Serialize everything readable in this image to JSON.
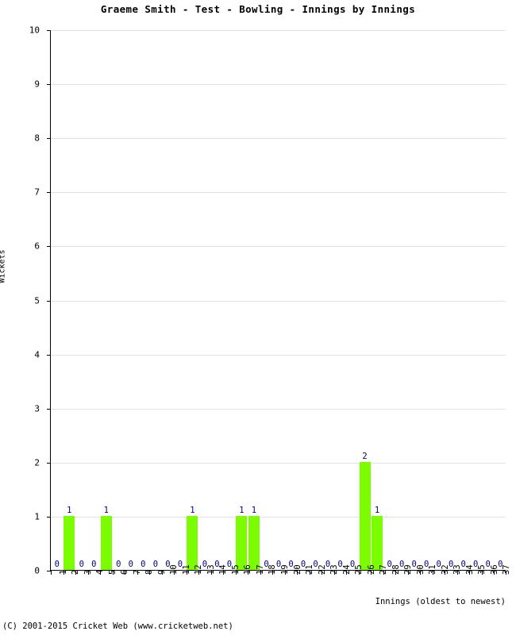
{
  "chart_data": {
    "type": "bar",
    "title": "Graeme Smith - Test - Bowling - Innings by Innings",
    "xlabel": "Innings (oldest to newest)",
    "ylabel": "Wickets",
    "ylim": [
      0,
      10
    ],
    "ytick_labels": [
      "0",
      "1",
      "2",
      "3",
      "4",
      "5",
      "6",
      "7",
      "8",
      "9",
      "10"
    ],
    "ytick_values": [
      0,
      1,
      2,
      3,
      4,
      5,
      6,
      7,
      8,
      9,
      10
    ],
    "grid": true,
    "legend": null,
    "bar_color": "#7CFC00",
    "value_label_color": "#000080",
    "gridline_color": "#E2E2E2",
    "axis_color": "#000000",
    "categories": [
      "1",
      "2",
      "3",
      "4",
      "5",
      "6",
      "7",
      "8",
      "9",
      "10",
      "11",
      "12",
      "13",
      "14",
      "15",
      "16",
      "17",
      "18",
      "19",
      "20",
      "21",
      "22",
      "23",
      "24",
      "25",
      "26",
      "27",
      "28",
      "29",
      "30",
      "31",
      "32",
      "33",
      "34",
      "35",
      "36",
      "37"
    ],
    "values": [
      0,
      1,
      0,
      0,
      1,
      0,
      0,
      0,
      0,
      0,
      0,
      1,
      0,
      0,
      0,
      1,
      1,
      0,
      0,
      0,
      0,
      0,
      0,
      0,
      0,
      2,
      1,
      0,
      0,
      0,
      0,
      0,
      0,
      0,
      0,
      0,
      0
    ],
    "data_labels": [
      "0",
      "1",
      "0",
      "0",
      "1",
      "0",
      "0",
      "0",
      "0",
      "0",
      "0",
      "1",
      "0",
      "0",
      "0",
      "1",
      "1",
      "0",
      "0",
      "0",
      "0",
      "0",
      "0",
      "0",
      "0",
      "2",
      "1",
      "0",
      "0",
      "0",
      "0",
      "0",
      "0",
      "0",
      "0",
      "0",
      "0"
    ]
  },
  "footer": {
    "copyright": "(C) 2001-2015 Cricket Web (www.cricketweb.net)"
  }
}
